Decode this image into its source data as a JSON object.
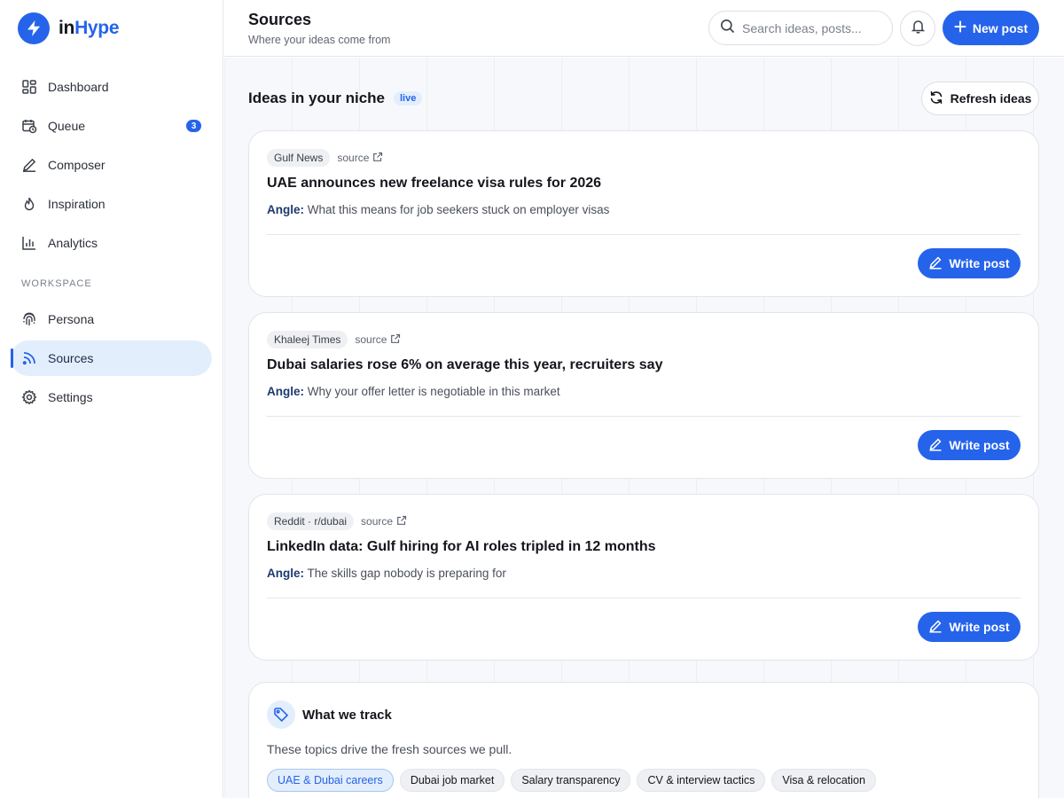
{
  "brand": {
    "name_in": "in",
    "name_hype": "Hype"
  },
  "nav": {
    "items": [
      {
        "label": "Dashboard",
        "icon": "dashboard-icon"
      },
      {
        "label": "Queue",
        "icon": "calendar-clock-icon",
        "badge": "3"
      },
      {
        "label": "Composer",
        "icon": "pencil-icon"
      },
      {
        "label": "Inspiration",
        "icon": "flame-icon"
      },
      {
        "label": "Analytics",
        "icon": "bar-chart-icon"
      }
    ],
    "section_label": "WORKSPACE",
    "workspace_items": [
      {
        "label": "Persona",
        "icon": "fingerprint-icon"
      },
      {
        "label": "Sources",
        "icon": "rss-icon",
        "active": true
      },
      {
        "label": "Settings",
        "icon": "gear-icon"
      }
    ]
  },
  "header": {
    "title": "Sources",
    "subtitle": "Where your ideas come from",
    "search_placeholder": "Search ideas, posts...",
    "new_post_label": "New post"
  },
  "section": {
    "title": "Ideas in your niche",
    "badge": "live",
    "refresh_label": "Refresh ideas"
  },
  "ideas": [
    {
      "source": "Gulf News",
      "link_label": "source",
      "title": "UAE announces new freelance visa rules for 2026",
      "angle_label": "Angle:",
      "angle": "What this means for job seekers stuck on employer visas",
      "button": "Write post"
    },
    {
      "source": "Khaleej Times",
      "link_label": "source",
      "title": "Dubai salaries rose 6% on average this year, recruiters say",
      "angle_label": "Angle:",
      "angle": "Why your offer letter is negotiable in this market",
      "button": "Write post"
    },
    {
      "source": "Reddit · r/dubai",
      "link_label": "source",
      "title": "LinkedIn data: Gulf hiring for AI roles tripled in 12 months",
      "angle_label": "Angle:",
      "angle": "The skills gap nobody is preparing for",
      "button": "Write post"
    }
  ],
  "tracking": {
    "title": "What we track",
    "description": "These topics drive the fresh sources we pull.",
    "topics": [
      "UAE & Dubai careers",
      "Dubai job market",
      "Salary transparency",
      "CV & interview tactics",
      "Visa & relocation"
    ],
    "active_topic": 0
  },
  "colors": {
    "accent": "#2563eb",
    "accent_soft": "#e3eefc",
    "text": "#14161c"
  }
}
